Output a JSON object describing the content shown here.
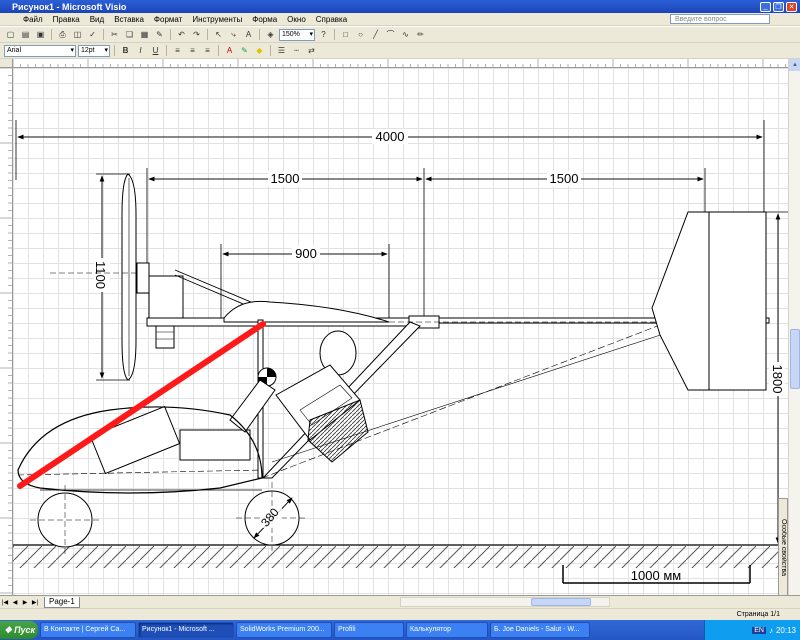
{
  "window": {
    "title": "Рисунок1 - Microsoft Visio"
  },
  "menu": {
    "items": [
      "Файл",
      "Правка",
      "Вид",
      "Вставка",
      "Формат",
      "Инструменты",
      "Форма",
      "Окно",
      "Справка"
    ],
    "help_placeholder": "Введите вопрос"
  },
  "toolbar": {
    "zoom": "150%",
    "font": "Arial",
    "font_size": "12pt"
  },
  "drawing": {
    "dim_total": "4000",
    "dim_left": "1500",
    "dim_right": "1500",
    "dim_cabin": "900",
    "dim_prop": "1100",
    "dim_tail": "1800",
    "dim_wheel": "380",
    "scale_label": "1000 мм"
  },
  "side_panel": "Особые свойства",
  "tabs": {
    "page": "Page-1"
  },
  "status": {
    "page_info": "Страница 1/1"
  },
  "taskbar": {
    "start": "Пуск",
    "tasks": [
      "В Контакте | Сергей Са...",
      "Рисунок1 - Microsoft ...",
      "SolidWorks Premium 200...",
      "Profili",
      "Калькулятор",
      "Б. Joe Daniels - Salut - W..."
    ],
    "lang": "EN",
    "time": "20:13"
  }
}
